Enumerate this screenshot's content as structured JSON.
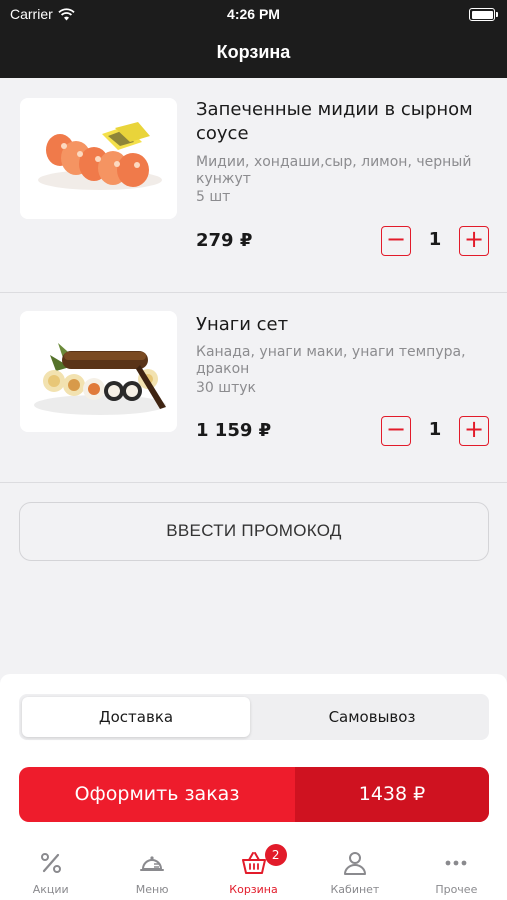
{
  "status_bar": {
    "carrier": "Carrier",
    "time": "4:26 PM"
  },
  "header": {
    "title": "Корзина"
  },
  "cart_items": [
    {
      "name": "Запеченные мидии в сырном соусе",
      "description": "Мидии, хондаши,сыр, лимон, черный кунжут",
      "quantity_label": "5 шт",
      "price": "279 ₽",
      "count": "1",
      "minus_label": "−",
      "plus_label": "+"
    },
    {
      "name": "Унаги сет",
      "description": "Канада, унаги маки, унаги темпура, дракон",
      "quantity_label": "30 штук",
      "price": "1 159 ₽",
      "count": "1",
      "minus_label": "−",
      "plus_label": "+"
    }
  ],
  "promo": {
    "label": "ВВЕСТИ ПРОМОКОД"
  },
  "delivery_toggle": {
    "options": [
      "Доставка",
      "Самовывоз"
    ],
    "selected": "Доставка"
  },
  "checkout": {
    "label": "Оформить заказ",
    "total": "1438 ₽"
  },
  "tab_bar": {
    "items": [
      {
        "label": "Акции",
        "icon": "percent-icon"
      },
      {
        "label": "Меню",
        "icon": "menu-cloche-icon"
      },
      {
        "label": "Корзина",
        "icon": "basket-icon",
        "badge": "2",
        "active": true
      },
      {
        "label": "Кабинет",
        "icon": "person-icon"
      },
      {
        "label": "Прочее",
        "icon": "more-dots-icon"
      }
    ]
  },
  "colors": {
    "accent": "#e21b2a",
    "header_bg": "#1c1c1c",
    "page_bg": "#f2f2f4",
    "checkout_dark": "#cf1220"
  }
}
